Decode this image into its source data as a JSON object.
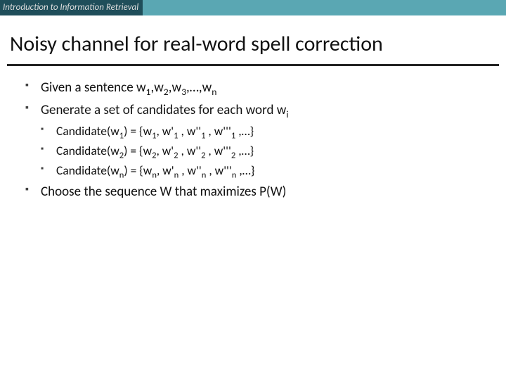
{
  "header": {
    "course": "Introduction to Information Retrieval"
  },
  "title": "Noisy channel for real-word spell correction",
  "bullets": {
    "b1_pre": "Given a sentence w",
    "b1_s1": "1",
    "b1_m1": ",w",
    "b1_s2": "2",
    "b1_m2": ",w",
    "b1_s3": "3",
    "b1_m3": ",…,w",
    "b1_s4": "n",
    "b2_pre": "Generate a set of candidates for each word w",
    "b2_s1": "i",
    "c1_pre": "Candidate(w",
    "c1_s1": "1",
    "c1_m1": ") = {w",
    "c1_s2": "1",
    "c1_m2": ", w'",
    "c1_s3": "1",
    "c1_m3": " , w''",
    "c1_s4": "1",
    "c1_m4": " , w'''",
    "c1_s5": "1",
    "c1_m5": " ,…}",
    "c2_pre": "Candidate(w",
    "c2_s1": "2",
    "c2_m1": ") = {w",
    "c2_s2": "2",
    "c2_m2": ", w'",
    "c2_s3": "2",
    "c2_m3": " , w''",
    "c2_s4": "2",
    "c2_m4": " , w'''",
    "c2_s5": "2",
    "c2_m5": " ,…}",
    "c3_pre": "Candidate(w",
    "c3_s1": "n",
    "c3_m1": ") = {w",
    "c3_s2": "n",
    "c3_m2": ", w'",
    "c3_s3": "n",
    "c3_m3": " , w''",
    "c3_s4": "n",
    "c3_m4": " , w'''",
    "c3_s5": "n",
    "c3_m5": " ,…}",
    "b3": "Choose the sequence W that maximizes P(W)"
  }
}
